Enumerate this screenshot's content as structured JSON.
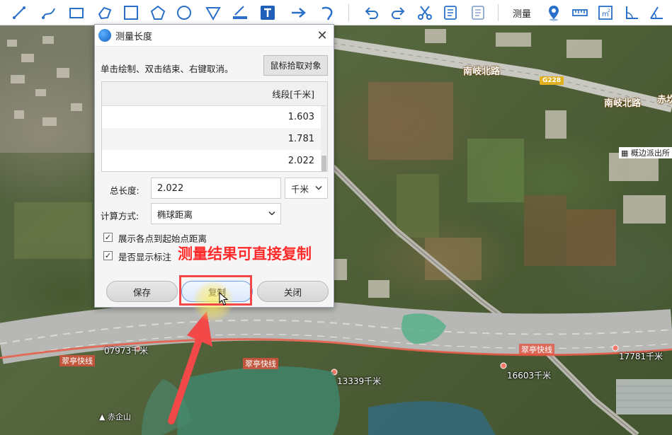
{
  "toolbar": {
    "measure_label": "测量",
    "icons": [
      "line-draw-icon",
      "curve-draw-icon",
      "rectangle-icon",
      "polygon-outline-icon",
      "square-icon",
      "pentagon-icon",
      "circle-icon",
      "inverted-triangle-icon",
      "ruler-pencil-icon",
      "text-icon",
      "arrow-right-icon",
      "curved-arrow-icon",
      "undo-icon",
      "redo-icon",
      "cut-icon",
      "document-icon",
      "document-copy-icon",
      "location-pin-icon",
      "ruler-icon",
      "area-measure-icon",
      "angle-measure-icon",
      "angle-shape-icon"
    ]
  },
  "map": {
    "road_north": "南岐北路",
    "road_north_2": "南岐北路",
    "highway_badge": "G228",
    "road_partial": "赤坎",
    "poi_police": "概边派出所",
    "poi_mountain": "赤企山",
    "expressway_label": "翠亭快线",
    "expressway_label_2": "翠亭快线",
    "expressway_label_3": "翠亭快线",
    "dist_1": "07973千米",
    "dist_2": "13339千米",
    "dist_3": "16603千米",
    "dist_4": "17781千米"
  },
  "dialog": {
    "title": "测量长度",
    "hint": "单击绘制、双击结束、右键取消。",
    "pick_button": "鼠标拾取对象",
    "table": {
      "header": "线段[千米]",
      "rows": [
        "1.603",
        "1.781",
        "2.022"
      ]
    },
    "total_label": "总长度:",
    "total_value": "2.022",
    "unit_selected": "千米",
    "method_label": "计算方式:",
    "method_selected": "椭球距离",
    "checkbox_1": {
      "label": "展示各点到起始点距离",
      "checked": true
    },
    "checkbox_2": {
      "label": "是否显示标注",
      "checked": true
    },
    "save_button": "保存",
    "copy_button": "复制",
    "close_button": "关闭"
  },
  "annotation": {
    "text": "测量结果可直接复制",
    "color": "#ff2a2a"
  }
}
